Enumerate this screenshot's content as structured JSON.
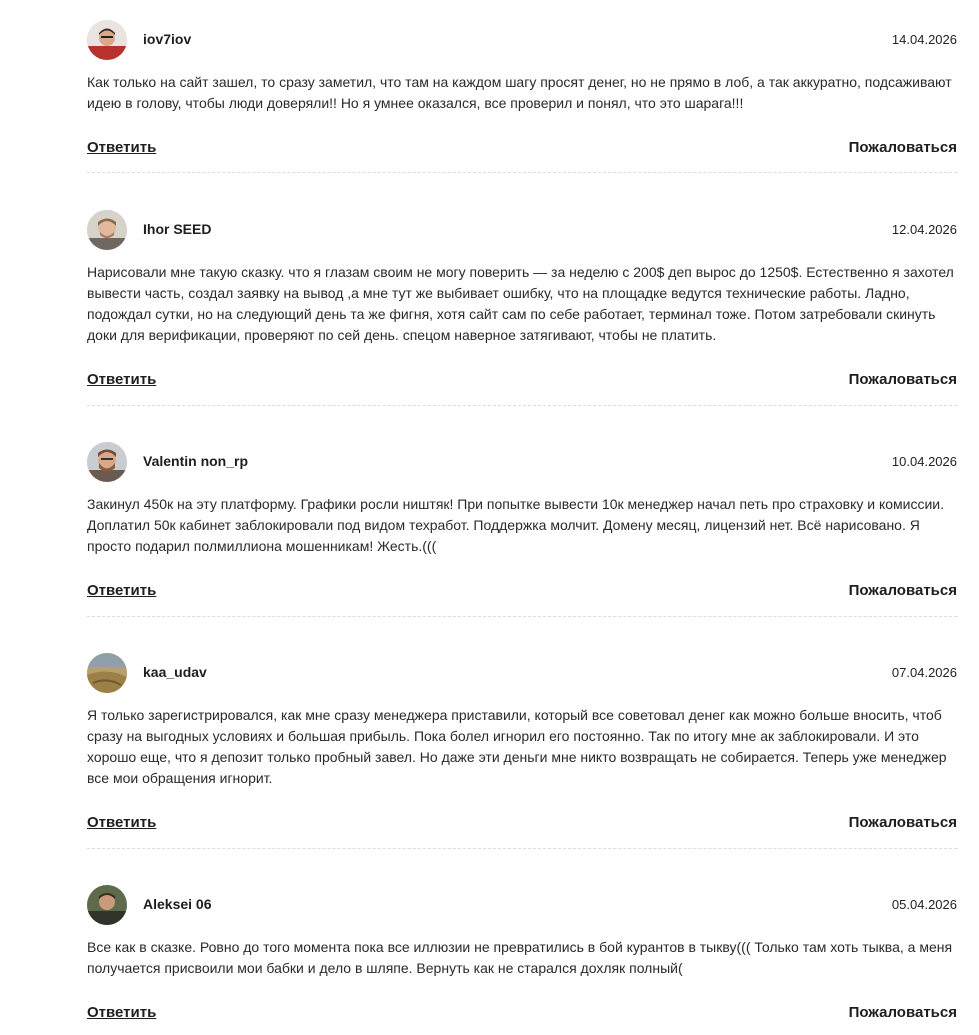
{
  "comments": [
    {
      "author": "iov7iov",
      "date": "14.04.2026",
      "text": "Как только на сайт зашел, то сразу заметил, что там на каждом шагу просят денег, но не прямо в лоб, а так аккуратно, подсаживают идею в голову, чтобы люди доверяли!! Но я умнее оказался, все проверил и понял, что это шарага!!!",
      "reply_label": "Ответить",
      "report_label": "Пожаловаться"
    },
    {
      "author": "Ihor SEED",
      "date": "12.04.2026",
      "text": "Нарисовали мне такую сказку. что я глазам своим не могу поверить — за неделю с 200$ деп вырос до 1250$. Естественно я захотел вывести часть, создал заявку на вывод ,а мне тут же выбивает ошибку, что на площадке ведутся технические работы. Ладно, подождал сутки, но на следующий день та же фигня, хотя сайт сам по себе работает, терминал тоже. Потом затребовали скинуть доки для верификации, проверяют по сей день. спецом наверное затягивают, чтобы не платить.",
      "reply_label": "Ответить",
      "report_label": "Пожаловаться"
    },
    {
      "author": "Valentin non_rp",
      "date": "10.04.2026",
      "text": "Закинул 450к на эту платформу. Графики росли ништяк! При попытке вывести 10к менеджер начал петь про страховку и комиссии. Доплатил 50к кабинет заблокировали под видом техработ. Поддержка молчит. Домену месяц, лицензий нет. Всё нарисовано. Я просто подарил полмиллиона мошенникам! Жесть.(((",
      "reply_label": "Ответить",
      "report_label": "Пожаловаться"
    },
    {
      "author": "kaa_udav",
      "date": "07.04.2026",
      "text": "Я только зарегистрировался, как мне сразу менеджера приставили, который все советовал денег как можно больше вносить, чтоб сразу на выгодных условиях и большая прибыль. Пока болел игнорил его постоянно. Так по итогу мне ак заблокировали. И это хорошо еще, что я депозит только пробный завел. Но даже эти деньги мне никто возвращать не собирается. Теперь уже менеджер все мои обращения игнорит.",
      "reply_label": "Ответить",
      "report_label": "Пожаловаться"
    },
    {
      "author": "Aleksei 06",
      "date": "05.04.2026",
      "text": "Все как в сказке. Ровно до того момента пока все иллюзии не превратились в бой курантов в тыкву((( Только там хоть тыква, а меня получается присвоили мои бабки и дело в шляпе. Вернуть как не старался дохляк полный(",
      "reply_label": "Ответить",
      "report_label": "Пожаловаться"
    }
  ]
}
